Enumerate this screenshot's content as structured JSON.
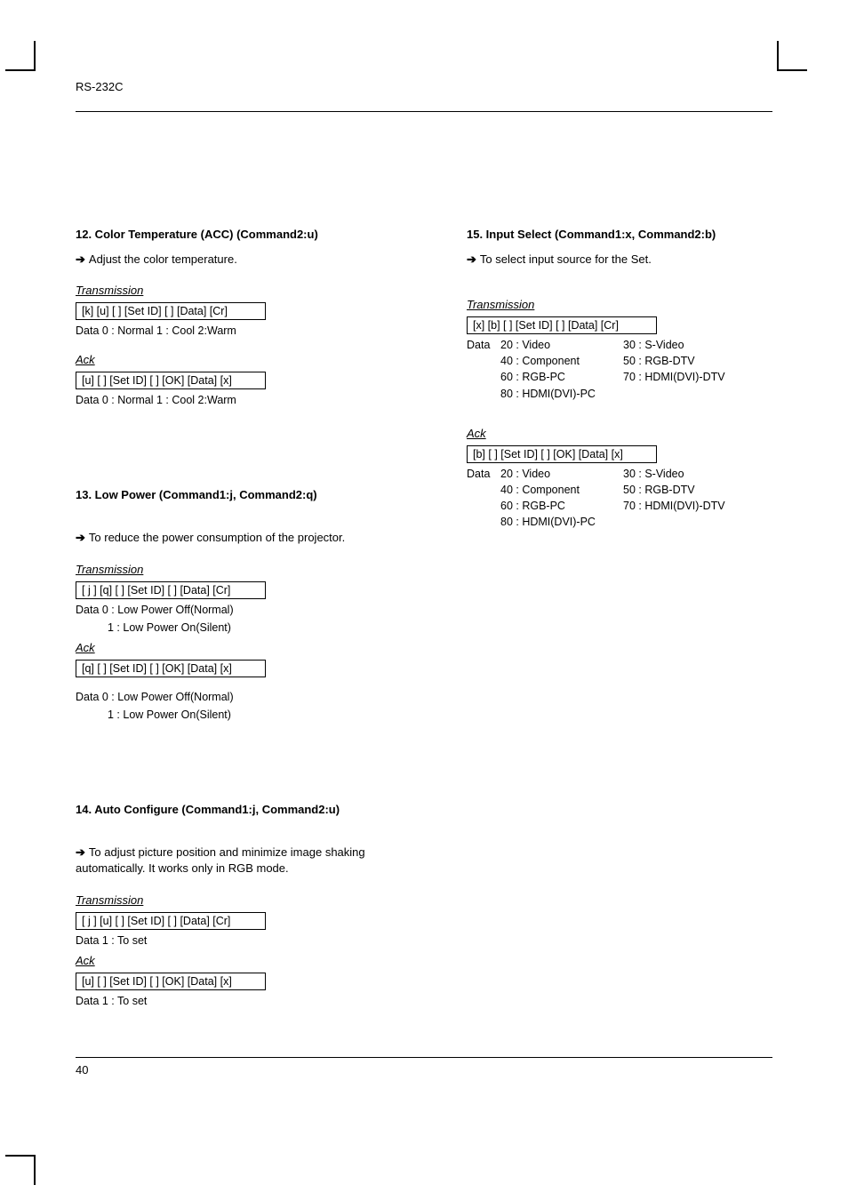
{
  "header": "RS-232C",
  "page_number": "40",
  "left": {
    "s12": {
      "title": "12. Color Temperature (ACC)  (Command2:u)",
      "desc": "Adjust the color temperature.",
      "trans_label": "Transmission",
      "trans_code": "[k] [u] [   ] [Set ID] [   ] [Data] [Cr]",
      "trans_data": "Data   0 : Normal      1 : Cool      2:Warm",
      "ack_label": "Ack",
      "ack_code": "[u] [   ] [Set ID] [   ] [OK] [Data] [x]",
      "ack_data": "Data   0 : Normal      1 : Cool      2:Warm"
    },
    "s13": {
      "title": "13. Low Power (Command1:j, Command2:q)",
      "desc": "To reduce the power consumption of the projector.",
      "trans_label": "Transmission",
      "trans_code": "[ j ] [q] [   ] [Set ID] [   ] [Data] [Cr]",
      "trans_data1": "Data   0 : Low Power Off(Normal)",
      "trans_data2": "1 : Low Power On(Silent)",
      "ack_label": "Ack",
      "ack_code": "[q] [   ] [Set ID] [   ] [OK] [Data] [x]",
      "ack_data1": "Data   0 : Low Power Off(Normal)",
      "ack_data2": "1 : Low Power On(Silent)"
    },
    "s14": {
      "title": "14. Auto Configure (Command1:j, Command2:u)",
      "desc": "To adjust picture position and minimize image shaking automatically. It works only in RGB mode.",
      "trans_label": "Transmission",
      "trans_code": "[ j ] [u] [   ] [Set ID] [   ] [Data] [Cr]",
      "trans_data": "Data   1 : To set",
      "ack_label": "Ack",
      "ack_code": "[u] [   ] [Set ID] [   ] [OK] [Data] [x]",
      "ack_data": "Data   1 : To set"
    }
  },
  "right": {
    "s15": {
      "title": "15. Input Select (Command1:x, Command2:b)",
      "desc": "To select input source for the Set.",
      "trans_label": "Transmission",
      "trans_code": "[x] [b] [   ] [Set ID] [   ] [Data] [Cr]",
      "data_label": "Data",
      "row1a": "20 : Video",
      "row1b": "30 : S-Video",
      "row2a": "40 : Component",
      "row2b": "50 : RGB-DTV",
      "row3a": "60 : RGB-PC",
      "row3b": "70 : HDMI(DVI)-DTV",
      "row4a": "80 : HDMI(DVI)-PC",
      "ack_label": "Ack",
      "ack_code": "[b] [   ] [Set ID] [   ] [OK] [Data] [x]"
    }
  }
}
